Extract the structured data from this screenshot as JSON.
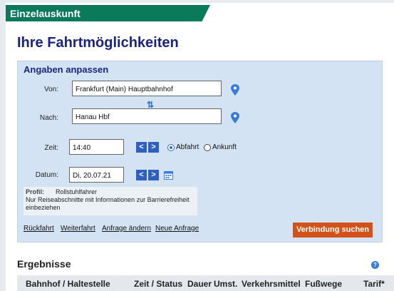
{
  "header": {
    "tab_label": "Einzelauskunft",
    "page_title": "Ihre Fahrtmöglichkeiten"
  },
  "panel": {
    "title": "Angaben anpassen",
    "from": {
      "label": "Von:",
      "value": "Frankfurt (Main) Hauptbahnhof"
    },
    "to": {
      "label": "Nach:",
      "value": "Hanau Hbf"
    },
    "time": {
      "label": "Zeit:",
      "value": "14:40"
    },
    "date": {
      "label": "Datum:",
      "value": "Di, 20.07.21"
    },
    "prev_label": "<",
    "next_label": ">",
    "departure_label": "Abfahrt",
    "arrival_label": "Ankunft",
    "selected_mode": "Abfahrt",
    "profile": {
      "label": "Profil:",
      "value": "Rollstuhlfahrer",
      "description": "Nur Reiseabschnitte mit Informationen zur Barrierefreiheit einbeziehen"
    },
    "links": [
      "Rückfahrt",
      "Weiterfahrt",
      "Anfrage ändern",
      "Neue Anfrage"
    ],
    "search_button": "Verbindung suchen"
  },
  "results": {
    "title": "Ergebnisse",
    "help_label": "?",
    "columns": [
      "Bahnhof / Haltestelle",
      "Zeit / Status",
      "Dauer",
      "Umst.",
      "Verkehrsmittel",
      "Fußwege",
      "Tarif*"
    ]
  },
  "colors": {
    "tab": "#0a7a5a",
    "title": "#1a237e",
    "panel": "#d4e3f3",
    "button": "#d4521a",
    "accent": "#2f6fd1"
  },
  "icons": [
    "location-pin-icon",
    "swap-icon",
    "chevron-left-icon",
    "chevron-right-icon",
    "calendar-icon",
    "help-icon"
  ]
}
